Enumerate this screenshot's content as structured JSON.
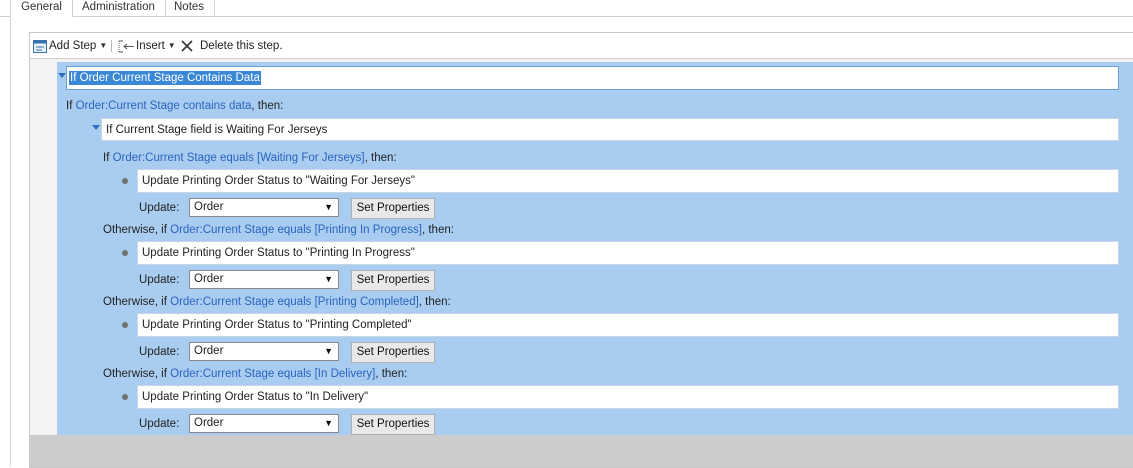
{
  "tabs": [
    {
      "label": "General",
      "active": true
    },
    {
      "label": "Administration",
      "active": false
    },
    {
      "label": "Notes",
      "active": false
    }
  ],
  "toolbar": {
    "add_step": "Add Step",
    "insert": "Insert",
    "delete": "Delete this step."
  },
  "root_step": {
    "name": "If Order Current Stage Contains Data",
    "cond_prefix": "If",
    "cond_link": "Order:Current Stage contains data",
    "cond_suffix": ", then:"
  },
  "inner_step": {
    "name": "If Current Stage field is Waiting For Jerseys"
  },
  "branches": [
    {
      "prefix": "If",
      "link": "Order:Current Stage equals [Waiting For Jerseys]",
      "suffix": ", then:",
      "action": "Update Printing Order Status to \"Waiting For Jerseys\"",
      "update_label": "Update:",
      "update_value": "Order",
      "button": "Set Properties"
    },
    {
      "prefix": "Otherwise, if",
      "link": "Order:Current Stage equals [Printing In Progress]",
      "suffix": ", then:",
      "action": "Update Printing Order Status to \"Printing In Progress\"",
      "update_label": "Update:",
      "update_value": "Order",
      "button": "Set Properties"
    },
    {
      "prefix": "Otherwise, if",
      "link": "Order:Current Stage equals [Printing Completed]",
      "suffix": ", then:",
      "action": "Update Printing Order Status to \"Printing Completed\"",
      "update_label": "Update:",
      "update_value": "Order",
      "button": "Set Properties"
    },
    {
      "prefix": "Otherwise, if",
      "link": "Order:Current Stage equals [In Delivery]",
      "suffix": ", then:",
      "action": "Update Printing Order Status to \"In Delivery\"",
      "update_label": "Update:",
      "update_value": "Order",
      "button": "Set Properties"
    }
  ],
  "colors": {
    "step_area": "#a8cdf0",
    "link": "#2a64c0",
    "selection": "#3a87d6"
  }
}
